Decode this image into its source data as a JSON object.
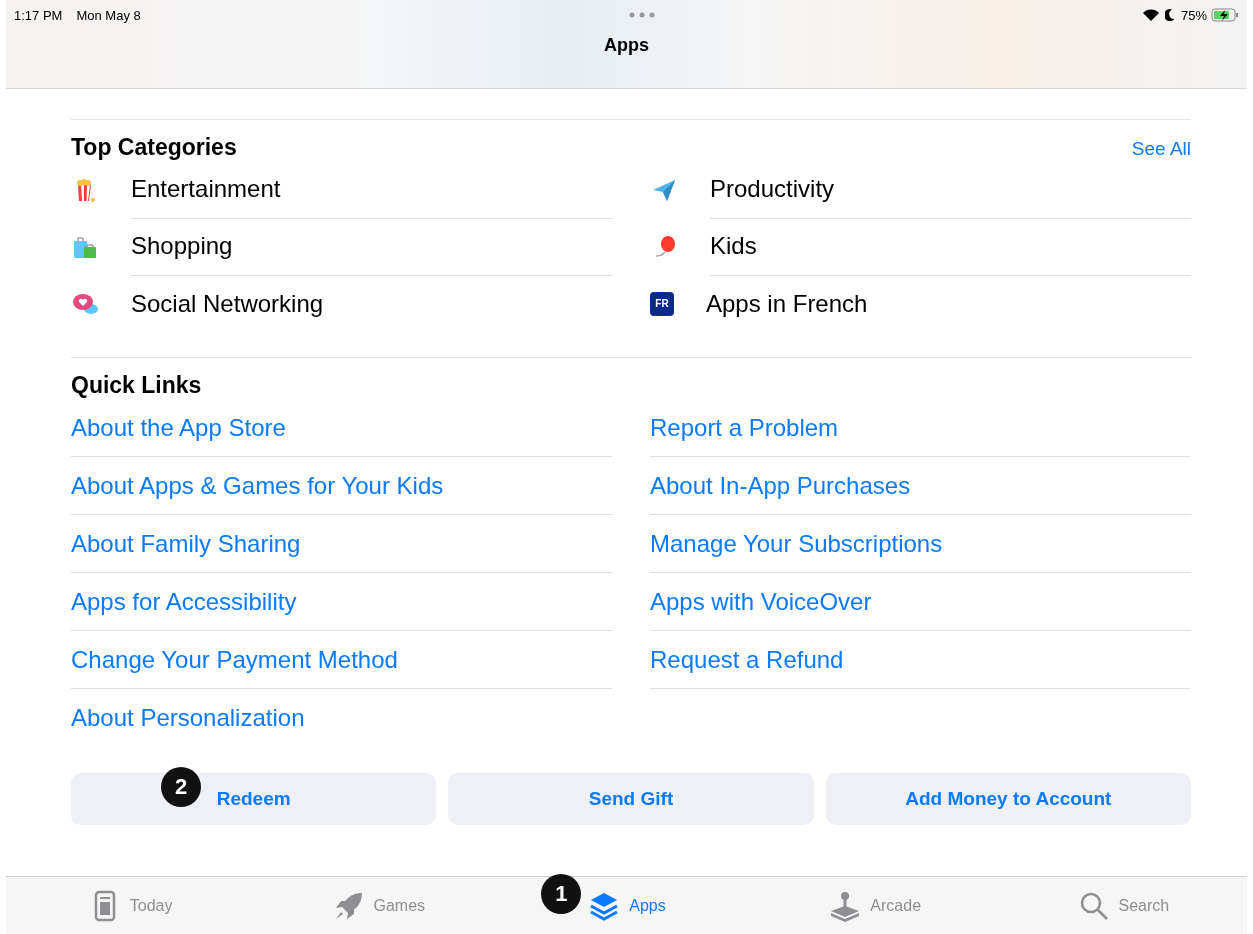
{
  "status_bar": {
    "time": "1:17 PM",
    "date": "Mon May 8",
    "battery": "75%"
  },
  "nav": {
    "title": "Apps"
  },
  "top_categories": {
    "title": "Top Categories",
    "see_all": "See All",
    "items": [
      {
        "label": "Entertainment",
        "kind": "popcorn"
      },
      {
        "label": "Productivity",
        "kind": "plane"
      },
      {
        "label": "Shopping",
        "kind": "bags"
      },
      {
        "label": "Kids",
        "kind": "balloon"
      },
      {
        "label": "Social Networking",
        "kind": "chat"
      },
      {
        "label": "Apps in French",
        "kind": "flag",
        "badge": "FR"
      }
    ]
  },
  "quick_links": {
    "title": "Quick Links",
    "items": [
      "About the App Store",
      "Report a Problem",
      "About Apps & Games for Your Kids",
      "About In-App Purchases",
      "About Family Sharing",
      "Manage Your Subscriptions",
      "Apps for Accessibility",
      "Apps with VoiceOver",
      "Change Your Payment Method",
      "Request a Refund",
      "About Personalization"
    ]
  },
  "buttons": [
    {
      "label": "Redeem",
      "callout": "2"
    },
    {
      "label": "Send Gift"
    },
    {
      "label": "Add Money to Account"
    }
  ],
  "tab_bar": [
    {
      "label": "Today",
      "kind": "today",
      "selected": false
    },
    {
      "label": "Games",
      "kind": "rocket",
      "selected": false
    },
    {
      "label": "Apps",
      "kind": "layers",
      "selected": true,
      "callout": "1"
    },
    {
      "label": "Arcade",
      "kind": "joystick",
      "selected": false
    },
    {
      "label": "Search",
      "kind": "search",
      "selected": false
    }
  ]
}
